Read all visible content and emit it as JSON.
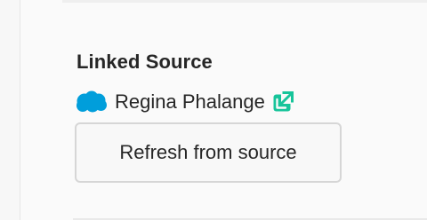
{
  "linked_source": {
    "title": "Linked Source",
    "source_icon": "salesforce-cloud-icon",
    "source_name": "Regina Phalange",
    "link_icon": "external-link-icon",
    "refresh_label": "Refresh from source"
  },
  "colors": {
    "cloud": "#009edb",
    "link_icon": "#17c49a",
    "text": "#262626",
    "button_border": "#d6d6d6",
    "background": "#fafafa"
  }
}
